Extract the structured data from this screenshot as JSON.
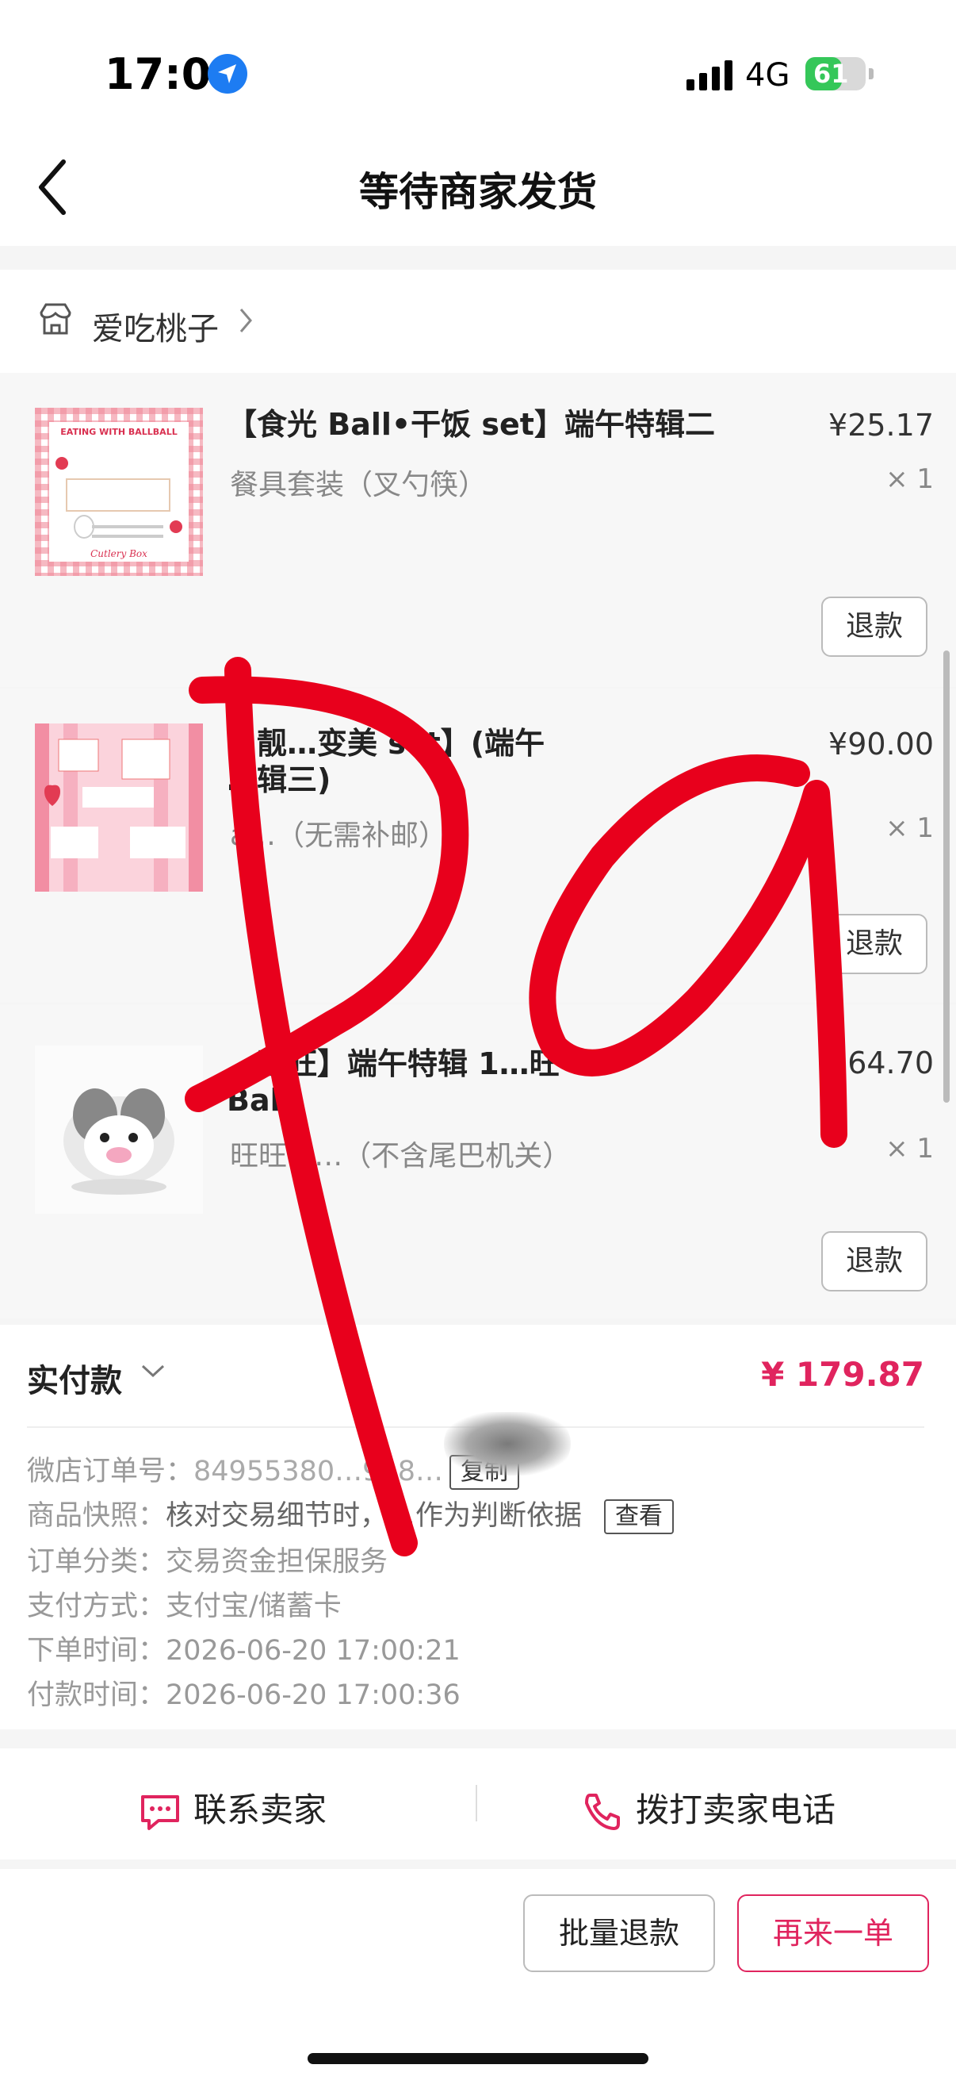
{
  "status_bar": {
    "time": "17:01",
    "network": "4G",
    "battery": "61",
    "battery_level": 0.61
  },
  "nav": {
    "title": "等待商家发货"
  },
  "shop": {
    "name": "爱吃桃子"
  },
  "items": [
    {
      "title": "【食光 Ball•干饭 set】端午特辑二",
      "spec": "餐具套装（叉勺筷）",
      "price": "¥25.17",
      "qty": "× 1",
      "refund_label": "退款"
    },
    {
      "title": "…靓…变美 set】(端午\n…辑三)",
      "spec": "a…（无需补邮）",
      "price": "¥90.00",
      "qty": "× 1",
      "refund_label": "退款"
    },
    {
      "title": "…旺旺】端午特辑 1…旺\nBall",
      "spec": "旺旺 b…（不含尾巴机关）",
      "price": "…64.70",
      "qty": "× 1",
      "refund_label": "退款"
    }
  ],
  "payment": {
    "label": "实付款",
    "amount": "¥ 179.87"
  },
  "details": {
    "order_no_label": "微店订单号：",
    "order_no_value": "84955380…918…",
    "copy_label": "复制",
    "snapshot_label": "商品快照：",
    "snapshot_value": "核对交易细节时，…作为判断依据",
    "snapshot_btn": "查看",
    "category_label": "订单分类：",
    "category_value": "交易资金担保服务",
    "pay_method_label": "支付方式：",
    "pay_method_value": "支付宝/储蓄卡",
    "order_time_label": "下单时间：",
    "order_time_value": "2026-06-20 17:00:21",
    "pay_time_label": "付款时间：",
    "pay_time_value": "2026-06-20 17:00:36"
  },
  "contact": {
    "seller_label": "联系卖家",
    "call_label": "拨打卖家电话"
  },
  "actions": {
    "batch_refund": "批量退款",
    "reorder": "再来一单"
  },
  "colors": {
    "accent": "#e0245e",
    "annotation_red": "#e8001c"
  },
  "thumb_texts": {
    "t1_top": "EATING WITH BALLBALL",
    "t1_bottom": "Cutlery Box"
  }
}
